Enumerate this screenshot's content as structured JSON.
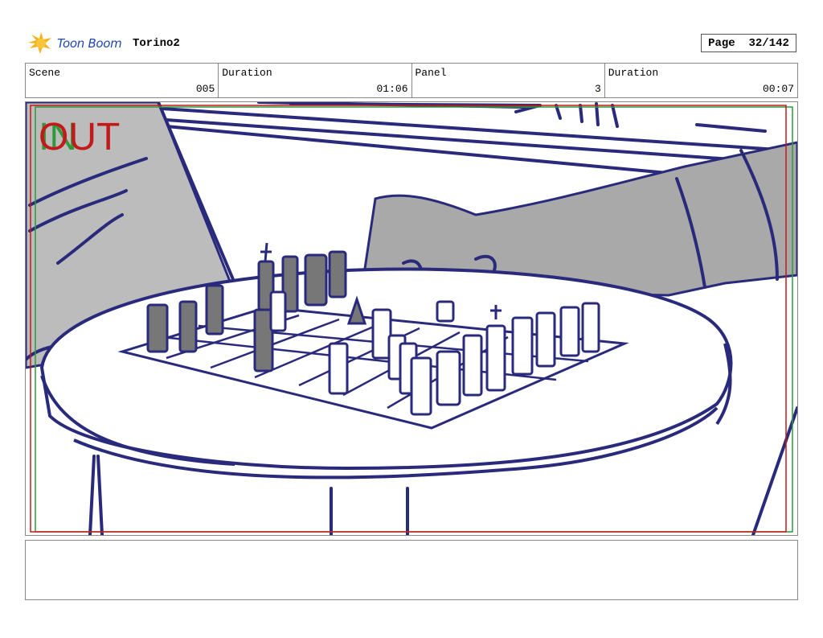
{
  "header": {
    "logo_text": "Toon Boom",
    "project_name": "Torino2",
    "page_label": "Page",
    "page_value": "32/142"
  },
  "info": [
    {
      "label": "Scene",
      "value": "005"
    },
    {
      "label": "Duration",
      "value": "01:06"
    },
    {
      "label": "Panel",
      "value": "3"
    },
    {
      "label": "Duration",
      "value": "00:07"
    }
  ],
  "panel": {
    "in_marker": "IN",
    "out_marker": "OUT"
  },
  "notes": {
    "text": ""
  },
  "colors": {
    "sketch_line": "#2a2a7c",
    "fill_gray": "#a9a9a9",
    "in_frame": "#2e9a3c",
    "out_frame": "#c21a1a"
  },
  "icons": {
    "logo": "toon-boom-logo-icon"
  }
}
